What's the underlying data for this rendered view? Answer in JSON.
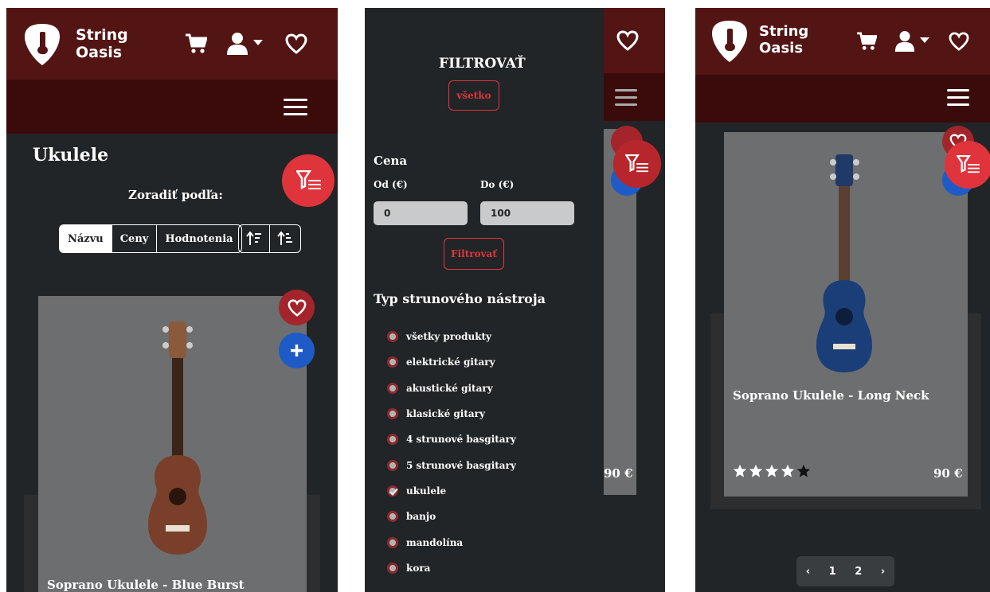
{
  "brand": {
    "line1": "String",
    "line2": "Oasis"
  },
  "catalog": {
    "title": "Ukulele",
    "sort_label": "Zoradiť podľa:",
    "sort_options": [
      "Názvu",
      "Ceny",
      "Hodnotenia"
    ],
    "active_sort": "Názvu"
  },
  "products": [
    {
      "name": "Soprano Ukulele - Blue Burst"
    },
    {
      "name": "Soprano Ukulele - Long Neck",
      "price": "90 €",
      "rating": 4,
      "rating_max": 5
    }
  ],
  "partial_price": "90 €",
  "filter": {
    "title": "FILTROVAŤ",
    "all_button": "všetko",
    "price_label": "Cena",
    "from_label": "Od (€)",
    "to_label": "Do (€)",
    "from_value": "0",
    "to_value": "100",
    "apply_button": "Filtrovať",
    "type_label": "Typ strunového nástroja",
    "types": [
      {
        "label": "všetky produkty",
        "checked": false
      },
      {
        "label": "elektrické gitary",
        "checked": false
      },
      {
        "label": "akustické gitary",
        "checked": false
      },
      {
        "label": "klasické gitary",
        "checked": false
      },
      {
        "label": "4 strunové basgitary",
        "checked": false
      },
      {
        "label": "5 strunové basgitary",
        "checked": false
      },
      {
        "label": "ukulele",
        "checked": true
      },
      {
        "label": "banjo",
        "checked": false
      },
      {
        "label": "mandolína",
        "checked": false
      },
      {
        "label": "kora",
        "checked": false
      }
    ]
  },
  "pagination": {
    "prev": "‹",
    "pages": [
      "1",
      "2"
    ],
    "next": "›"
  },
  "colors": {
    "header": "#531414",
    "subheader": "#3b0b0b",
    "background": "#222527",
    "accent": "#e0343c",
    "favorite": "#a3252b",
    "add": "#1e5bc6"
  },
  "icons": [
    "cart-icon",
    "user-icon",
    "heart-icon",
    "menu-icon",
    "filter-icon",
    "plus-icon",
    "star-icon",
    "guitar-pick-logo"
  ]
}
